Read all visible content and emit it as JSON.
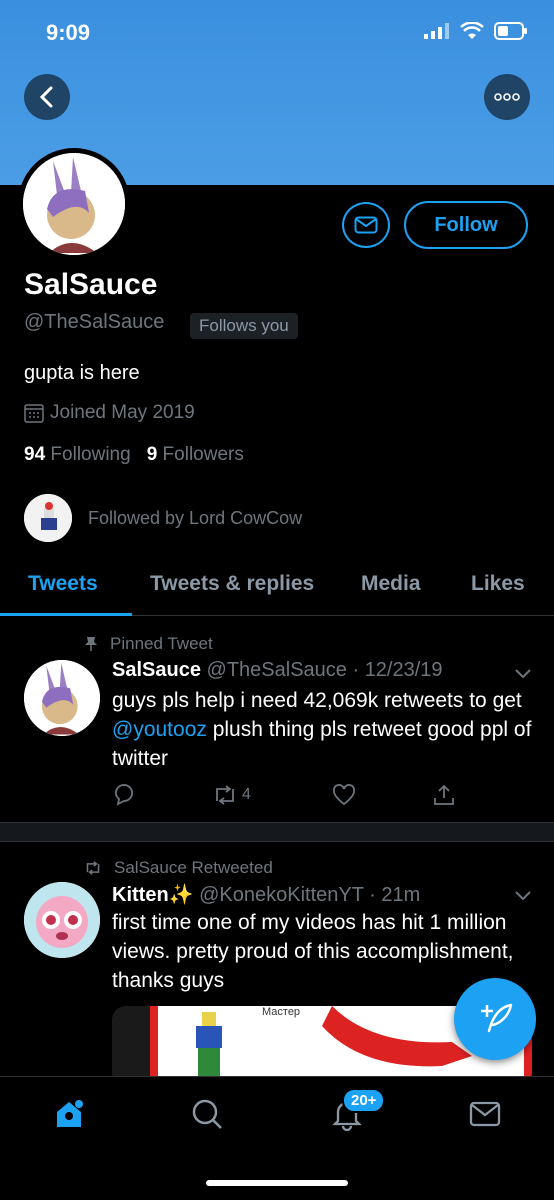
{
  "status": {
    "time": "9:09"
  },
  "profile": {
    "display_name": "SalSauce",
    "handle": "@TheSalSauce",
    "follows_you": "Follows you",
    "bio": "gupta is here",
    "joined": "Joined May 2019",
    "following_count": "94",
    "following_label": "Following",
    "followers_count": "9",
    "followers_label": "Followers",
    "followed_by": "Followed by Lord CowCow",
    "follow_button": "Follow"
  },
  "tabs": [
    {
      "label": "Tweets",
      "active": true
    },
    {
      "label": "Tweets & replies",
      "active": false
    },
    {
      "label": "Media",
      "active": false
    },
    {
      "label": "Likes",
      "active": false
    }
  ],
  "tweets": [
    {
      "context": "Pinned Tweet",
      "name": "SalSauce",
      "handle": "@TheSalSauce",
      "date": "12/23/19",
      "text_before": "guys pls help i need 42,069k retweets to get ",
      "mention": "@youtooz",
      "text_after": " plush thing pls retweet good ppl of twitter",
      "retweets": "4"
    },
    {
      "context": "SalSauce Retweeted",
      "name": "Kitten✨",
      "handle": "@KonekoKittenYT",
      "date": "21m",
      "text": "first time one of my videos has hit 1 million views. pretty proud of this accomplishment, thanks guys",
      "media_caption": "Мастер"
    }
  ],
  "bottom_nav": {
    "notifications_badge": "20+"
  },
  "colors": {
    "accent": "#1da1f2",
    "banner": "#4b9ee5",
    "muted": "#6e767d"
  }
}
